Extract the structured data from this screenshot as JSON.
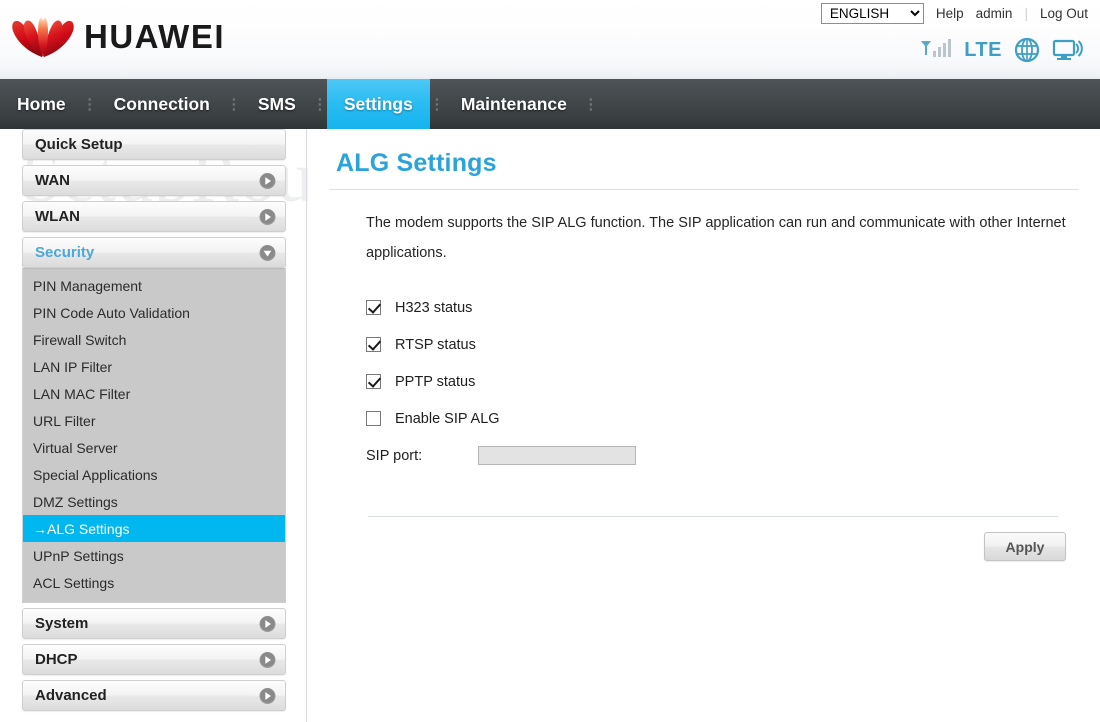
{
  "brand": {
    "name": "HUAWEI",
    "logo_icon": "huawei-flower-logo",
    "logo_color": "#cc0000"
  },
  "topbar": {
    "language_selected": "ENGLISH",
    "language_options": [
      "ENGLISH"
    ],
    "help_label": "Help",
    "user_label": "admin",
    "logout_label": "Log Out",
    "separator": "|"
  },
  "status": {
    "signal_icon": "signal-bars-icon",
    "network_label": "LTE",
    "internet_icon": "globe-icon",
    "device_icon": "monitor-wifi-icon",
    "accent_color": "#3d9fc6"
  },
  "nav": {
    "items": [
      {
        "label": "Home",
        "active": false
      },
      {
        "label": "Connection",
        "active": false
      },
      {
        "label": "SMS",
        "active": false
      },
      {
        "label": "Settings",
        "active": true
      },
      {
        "label": "Maintenance",
        "active": false
      }
    ],
    "active_color": "#16b3ee"
  },
  "sidebar": {
    "groups": [
      {
        "label": "Quick Setup",
        "arrow": null,
        "expanded": false,
        "items": []
      },
      {
        "label": "WAN",
        "arrow": "chevron-right-icon",
        "expanded": false,
        "items": []
      },
      {
        "label": "WLAN",
        "arrow": "chevron-right-icon",
        "expanded": false,
        "items": []
      },
      {
        "label": "Security",
        "arrow": "chevron-down-icon",
        "expanded": true,
        "items": [
          {
            "label": "PIN Management",
            "selected": false
          },
          {
            "label": "PIN Code Auto Validation",
            "selected": false
          },
          {
            "label": "Firewall Switch",
            "selected": false
          },
          {
            "label": "LAN IP Filter",
            "selected": false
          },
          {
            "label": "LAN MAC Filter",
            "selected": false
          },
          {
            "label": "URL Filter",
            "selected": false
          },
          {
            "label": "Virtual Server",
            "selected": false
          },
          {
            "label": "Special Applications",
            "selected": false
          },
          {
            "label": "DMZ Settings",
            "selected": false
          },
          {
            "label": "→ALG Settings",
            "selected": true
          },
          {
            "label": "UPnP Settings",
            "selected": false
          },
          {
            "label": "ACL Settings",
            "selected": false
          }
        ]
      },
      {
        "label": "System",
        "arrow": "chevron-right-icon",
        "expanded": false,
        "items": []
      },
      {
        "label": "DHCP",
        "arrow": "chevron-right-icon",
        "expanded": false,
        "items": []
      },
      {
        "label": "Advanced",
        "arrow": "chevron-right-icon",
        "expanded": false,
        "items": []
      }
    ],
    "selected_bg": "#00b7f0",
    "expanded_label_color": "#4aa9d8"
  },
  "main": {
    "title": "ALG Settings",
    "title_color": "#29a3d9",
    "description": "The modem supports the SIP ALG function. The SIP application can run and communicate with other Internet applications.",
    "checkboxes": [
      {
        "label": "H323 status",
        "checked": true
      },
      {
        "label": "RTSP status",
        "checked": true
      },
      {
        "label": "PPTP status",
        "checked": true
      },
      {
        "label": "Enable SIP ALG",
        "checked": false
      }
    ],
    "sip_port": {
      "label": "SIP port:",
      "value": "",
      "placeholder": "",
      "disabled": true
    },
    "apply_label": "Apply"
  },
  "watermark": {
    "text": "SetupRouter.com"
  }
}
